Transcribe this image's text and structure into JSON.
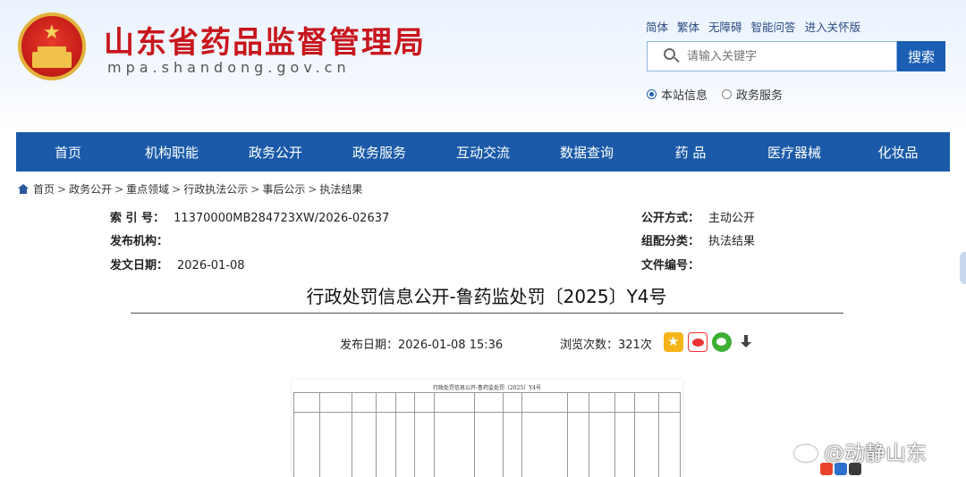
{
  "header": {
    "site_title": "山东省药品监督管理局",
    "site_domain": "mpa.shandong.gov.cn",
    "top_links": [
      "简体",
      "繁体",
      "无障碍",
      "智能问答",
      "进入关怀版"
    ],
    "search_placeholder": "请输入关键字",
    "search_button": "搜索",
    "scope_options": [
      {
        "label": "本站信息",
        "selected": true
      },
      {
        "label": "政务服务",
        "selected": false
      }
    ]
  },
  "nav": [
    "首页",
    "机构职能",
    "政务公开",
    "政务服务",
    "互动交流",
    "数据查询",
    "药 品",
    "医疗器械",
    "化妆品"
  ],
  "breadcrumb": [
    "首页",
    "政务公开",
    "重点领域",
    "行政执法公示",
    "事后公示",
    "执法结果"
  ],
  "meta": {
    "index_label": "索 引 号：",
    "index_value": "11370000MB284723XW/2026-02637",
    "publisher_label": "发布机构：",
    "publisher_value": "",
    "date_label": "发文日期：",
    "date_value": "2026-01-08",
    "open_label": "公开方式：",
    "open_value": "主动公开",
    "category_label": "组配分类：",
    "category_value": "执法结果",
    "docno_label": "文件编号：",
    "docno_value": ""
  },
  "article": {
    "title": "行政处罚信息公开-鲁药监处罚〔2025〕Y4号",
    "publish_label": "发布日期：",
    "publish_time": "2026-01-08 15:36",
    "views_label": "浏览次数：",
    "views_count": "321",
    "views_unit": "次",
    "share_icons": [
      "qzone-icon",
      "weibo-icon",
      "wechat-icon",
      "download-icon"
    ]
  },
  "document_image": {
    "title": "行政处罚信息公开-鲁药监处罚〔2025〕Y4号"
  },
  "watermark": "@动静山东",
  "colors": {
    "brand_red": "#c8161d",
    "nav_blue": "#1a5aa8",
    "button_blue": "#1a5fb4"
  }
}
